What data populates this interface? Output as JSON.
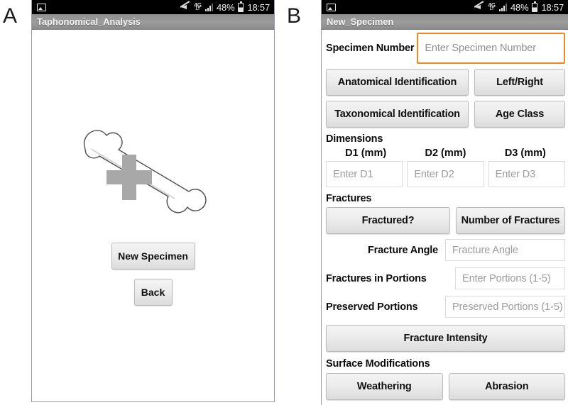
{
  "figure": {
    "panel_a_letter": "A",
    "panel_b_letter": "B"
  },
  "status_bar": {
    "battery_percent": "48%",
    "clock": "18:57",
    "network": "4G",
    "icons": [
      "image-icon",
      "mute-icon",
      "4g-icon",
      "signal-icon",
      "battery-icon"
    ]
  },
  "panel_a": {
    "app_title": "Taphonomical_Analysis",
    "artwork": "bone-illustration",
    "buttons": [
      {
        "label": "New Specimen"
      },
      {
        "label": "Back"
      }
    ]
  },
  "panel_b": {
    "app_title": "New_Specimen",
    "specimen": {
      "label": "Specimen Number",
      "placeholder": "Enter Specimen Number",
      "value": ""
    },
    "identification_buttons": [
      {
        "label": "Anatomical Identification"
      },
      {
        "label": "Left/Right"
      },
      {
        "label": "Taxonomical Identification"
      },
      {
        "label": "Age Class"
      }
    ],
    "dimensions": {
      "section_label": "Dimensions",
      "columns": [
        {
          "header": "D1 (mm)",
          "placeholder": "Enter D1",
          "value": ""
        },
        {
          "header": "D2 (mm)",
          "placeholder": "Enter D2",
          "value": ""
        },
        {
          "header": "D3 (mm)",
          "placeholder": "Enter D3",
          "value": ""
        }
      ]
    },
    "fractures": {
      "section_label": "Fractures",
      "buttons": [
        {
          "label": "Fractured?"
        },
        {
          "label": "Number of Fractures"
        }
      ],
      "angle": {
        "label": "Fracture Angle",
        "placeholder": "Fracture Angle",
        "value": ""
      },
      "portions": {
        "label": "Fractures in Portions",
        "placeholder": "Enter Portions (1-5)",
        "value": ""
      },
      "preserved": {
        "label": "Preserved Portions",
        "placeholder": "Preserved Portions (1-5)",
        "value": ""
      },
      "intensity_button": "Fracture Intensity"
    },
    "surface": {
      "section_label": "Surface Modifications",
      "buttons": [
        {
          "label": "Weathering"
        },
        {
          "label": "Abrasion"
        }
      ]
    }
  },
  "colors": {
    "focus_outline": "#f08a20",
    "title_bar": "#9c9c9c",
    "status_bar": "#000000",
    "button_face": "#ececec",
    "placeholder_text": "#9c9c9c"
  }
}
